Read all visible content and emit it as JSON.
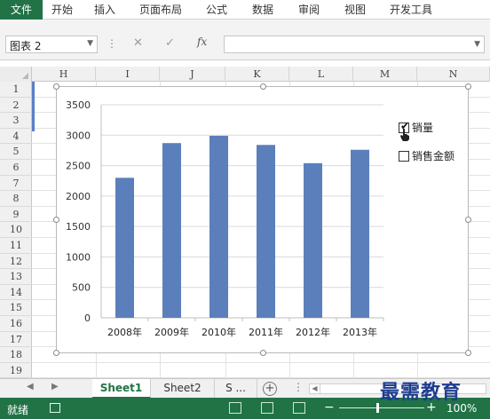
{
  "ribbon": {
    "tabs": [
      "文件",
      "开始",
      "插入",
      "页面布局",
      "公式",
      "数据",
      "审阅",
      "视图",
      "开发工具"
    ]
  },
  "formula_bar": {
    "name_box": "图表 2",
    "cancel_icon": "✕",
    "enter_icon": "✓",
    "fx_label": "fx",
    "content": ""
  },
  "columns": [
    "H",
    "I",
    "J",
    "K",
    "L",
    "M",
    "N"
  ],
  "rows": [
    "1",
    "2",
    "3",
    "4",
    "5",
    "6",
    "7",
    "8",
    "9",
    "10",
    "11",
    "12",
    "13",
    "14",
    "15",
    "16",
    "17",
    "18",
    "19"
  ],
  "chart_data": {
    "type": "bar",
    "categories": [
      "2008年",
      "2009年",
      "2010年",
      "2011年",
      "2012年",
      "2013年"
    ],
    "series": [
      {
        "name": "销量",
        "values": [
          2300,
          2870,
          2990,
          2840,
          2540,
          2760
        ],
        "color": "#5b7fbb",
        "checked": true
      }
    ],
    "ylim": [
      0,
      3500
    ],
    "yticks": [
      0,
      500,
      1000,
      1500,
      2000,
      2500,
      3000,
      3500
    ],
    "grid": true,
    "legend_position": "right"
  },
  "legend_checkboxes": [
    {
      "label": "销量",
      "checked": true
    },
    {
      "label": "销售金额",
      "checked": false
    }
  ],
  "sheet_tabs": {
    "tabs": [
      "Sheet1",
      "Sheet2",
      "S ..."
    ],
    "active": "Sheet1",
    "nav_left": "◀",
    "nav_right": "▶",
    "add": "+"
  },
  "status_bar": {
    "ready_text": "就绪",
    "zoom_minus": "−",
    "zoom_plus": "+",
    "zoom": "100%",
    "zoom_fraction": 0.44
  },
  "watermark": "最需教育"
}
